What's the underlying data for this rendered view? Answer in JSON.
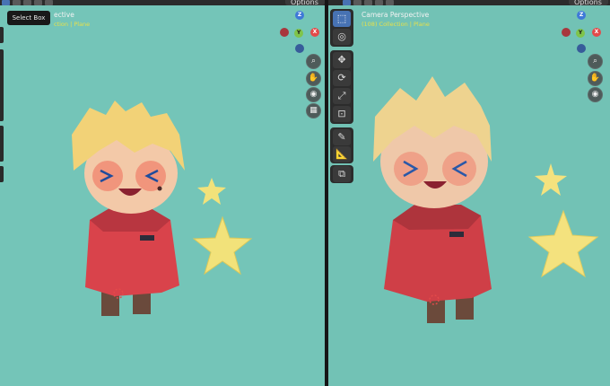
{
  "header": {
    "options_label": "Options"
  },
  "tooltip": {
    "text": "Select Box"
  },
  "left_viewport": {
    "title": "ective",
    "subtitle": "ction | Plane"
  },
  "right_viewport": {
    "title": "Camera Perspective",
    "subtitle": "(108) Collection | Plane"
  },
  "gizmo": {
    "x": "X",
    "y": "Y",
    "z": "Z"
  },
  "nav_icons": [
    "zoom-icon",
    "hand-pan-icon",
    "camera-icon",
    "grid-icon"
  ],
  "toolbar": {
    "tools": [
      "select-box",
      "cursor",
      "move",
      "rotate",
      "scale",
      "transform",
      "annotate",
      "measure",
      "add-cube"
    ]
  },
  "colors": {
    "viewport_bg": "#74c5b8",
    "active_tool": "#4772b3",
    "subtitle": "#e7e04a"
  }
}
